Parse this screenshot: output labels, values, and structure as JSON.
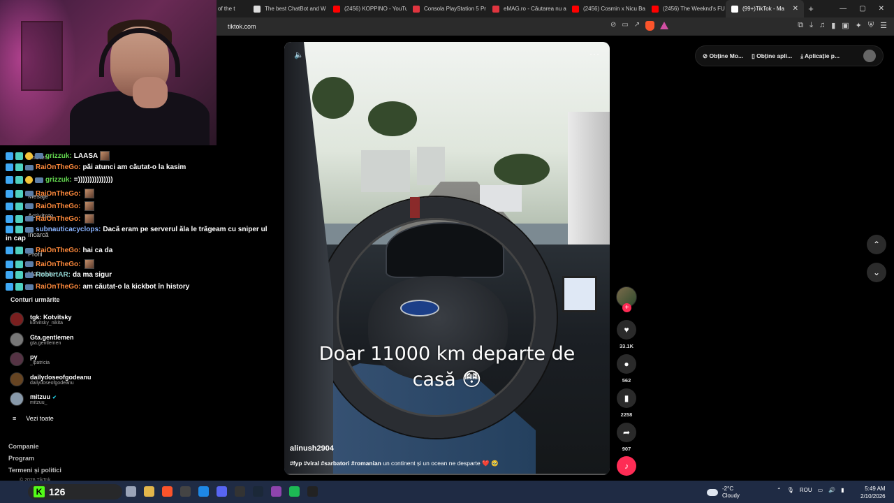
{
  "browser": {
    "tabs": [
      {
        "label": "of the t",
        "color": "#aaaaaa"
      },
      {
        "label": "The best ChatBot and W",
        "color": "#dddddd"
      },
      {
        "label": "(2456) KOPPINO - YouTu",
        "color": "#ff0000"
      },
      {
        "label": "Consola PlayStation 5 Pr",
        "color": "#e0353f"
      },
      {
        "label": "eMAG.ro - Căutarea nu a",
        "color": "#e0353f"
      },
      {
        "label": "(2456) Cosmin x Nicu Ba",
        "color": "#ff0000"
      },
      {
        "label": "(2456) The Weeknd's FU",
        "color": "#ff0000"
      },
      {
        "label": "(99+)TikTok - Ma",
        "color": "#ffffff"
      }
    ],
    "active_tab_close": "✕",
    "new_tab": "+",
    "url": "tiktok.com",
    "window_controls": [
      "—",
      "▢",
      "✕"
    ]
  },
  "chat": [
    {
      "user": "grizzuk:",
      "message": "LAASA",
      "user_color": "u-green",
      "emote": true
    },
    {
      "user": "RaiOnTheGo:",
      "message": "păi atunci am căutat-o la kasim",
      "user_color": "u-orange",
      "emote": false
    },
    {
      "user": "grizzuk:",
      "message": "=)))))))))))))))",
      "user_color": "u-green",
      "emote": false
    },
    {
      "user": "RaiOnTheGo:",
      "message": "",
      "user_color": "u-orange",
      "emote": true
    },
    {
      "user": "RaiOnTheGo:",
      "message": "",
      "user_color": "u-orange",
      "emote": true
    },
    {
      "user": "RaiOnTheGo:",
      "message": "",
      "user_color": "u-orange",
      "emote": true
    },
    {
      "user": "subnauticacyclops:",
      "message": "Dacă eram pe serverul ăla le trăgeam cu sniper ul",
      "user_color": "u-blue",
      "emote": false
    },
    {
      "user": "",
      "message": "in cap",
      "user_color": "u-blue",
      "emote": false
    },
    {
      "user": "RaiOnTheGo:",
      "message": "hai ca da",
      "user_color": "u-orange",
      "emote": false
    },
    {
      "user": "RaiOnTheGo:",
      "message": "",
      "user_color": "u-orange",
      "emote": true
    },
    {
      "user": "RobertAR:",
      "message": "da ma sigur",
      "user_color": "u-teal",
      "emote": false
    },
    {
      "user": "RaiOnTheGo:",
      "message": "am căutat-o la kickbot în history",
      "user_color": "u-orange",
      "emote": false
    }
  ],
  "sidebar_under": {
    "prieteni": "Prieteni",
    "mesaje": "Mesaje",
    "activitate": "Activitate",
    "incarca": "Încarcă",
    "profil": "Profil",
    "mai_multe": "Mai multe"
  },
  "followed": {
    "title": "Conturi urmărite",
    "accounts": [
      {
        "name": "tgk: Kotvitsky",
        "handle": "kotvitsky_nikita",
        "color": "#7a1f1f"
      },
      {
        "name": "Gta.gentlemen",
        "handle": "gta.gentlemen",
        "color": "#777777"
      },
      {
        "name": "py",
        "handle": "_lpatricia",
        "color": "#553344"
      },
      {
        "name": "dailydoseofgodeanu",
        "handle": "dailydoseofgodeanu",
        "color": "#664422"
      },
      {
        "name": "mitzuu",
        "handle": "mitzuu_",
        "color": "#8899aa"
      }
    ],
    "see_all": "Vezi toate",
    "verified": "✔"
  },
  "footer": {
    "companie": "Companie",
    "program": "Program",
    "termeni": "Termeni și politici",
    "copyright": "© 2026 TikTok"
  },
  "video": {
    "caption_line1": "Doar 11000 km departe de",
    "caption_line2": "casă 😳",
    "author": "alinush2904",
    "tags": "#fyp #viral #sarbatori #romanian",
    "desc": " un continent și un ocean ne desparte ❤️ 🥹",
    "mute_icon": "🔈",
    "more_icon": "···"
  },
  "actions": {
    "likes": "33.1K",
    "comments": "562",
    "saves": "2258",
    "shares": "907",
    "follow_plus": "+"
  },
  "top_pill": {
    "item1": "Obține Mo...",
    "item2": "Obține apli...",
    "item3": "Aplicație p..."
  },
  "taskbar": {
    "kick_count": "126",
    "kick_letter": "K",
    "weather_temp": "-2°C",
    "weather_desc": "Cloudy",
    "lang": "ROU",
    "time": "5:49 AM",
    "date": "2/10/2026",
    "app_colors": [
      "#9aa4b8",
      "#e3b64b",
      "#fb542b",
      "#444444",
      "#1e88e5",
      "#5865f2",
      "#333333",
      "#1b2838",
      "#8e44ad",
      "#1db954",
      "#222222"
    ]
  }
}
